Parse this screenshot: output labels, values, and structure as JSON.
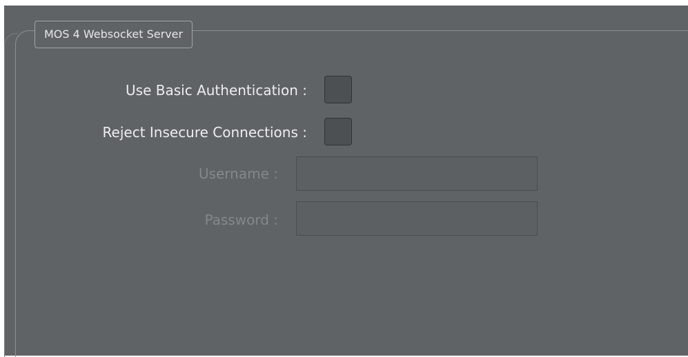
{
  "group": {
    "title": "MOS 4 Websocket Server"
  },
  "fields": {
    "basic_auth_label": "Use Basic Authentication :",
    "basic_auth_checked": false,
    "reject_insecure_label": "Reject Insecure Connections :",
    "reject_insecure_checked": false,
    "username_label": "Username :",
    "username_value": "",
    "password_label": "Password :",
    "password_value": ""
  },
  "colors": {
    "panel_background": "#5f6366",
    "label_enabled": "#eeeeee",
    "label_disabled": "#84888c",
    "checkbox_fill": "#4c5053"
  }
}
